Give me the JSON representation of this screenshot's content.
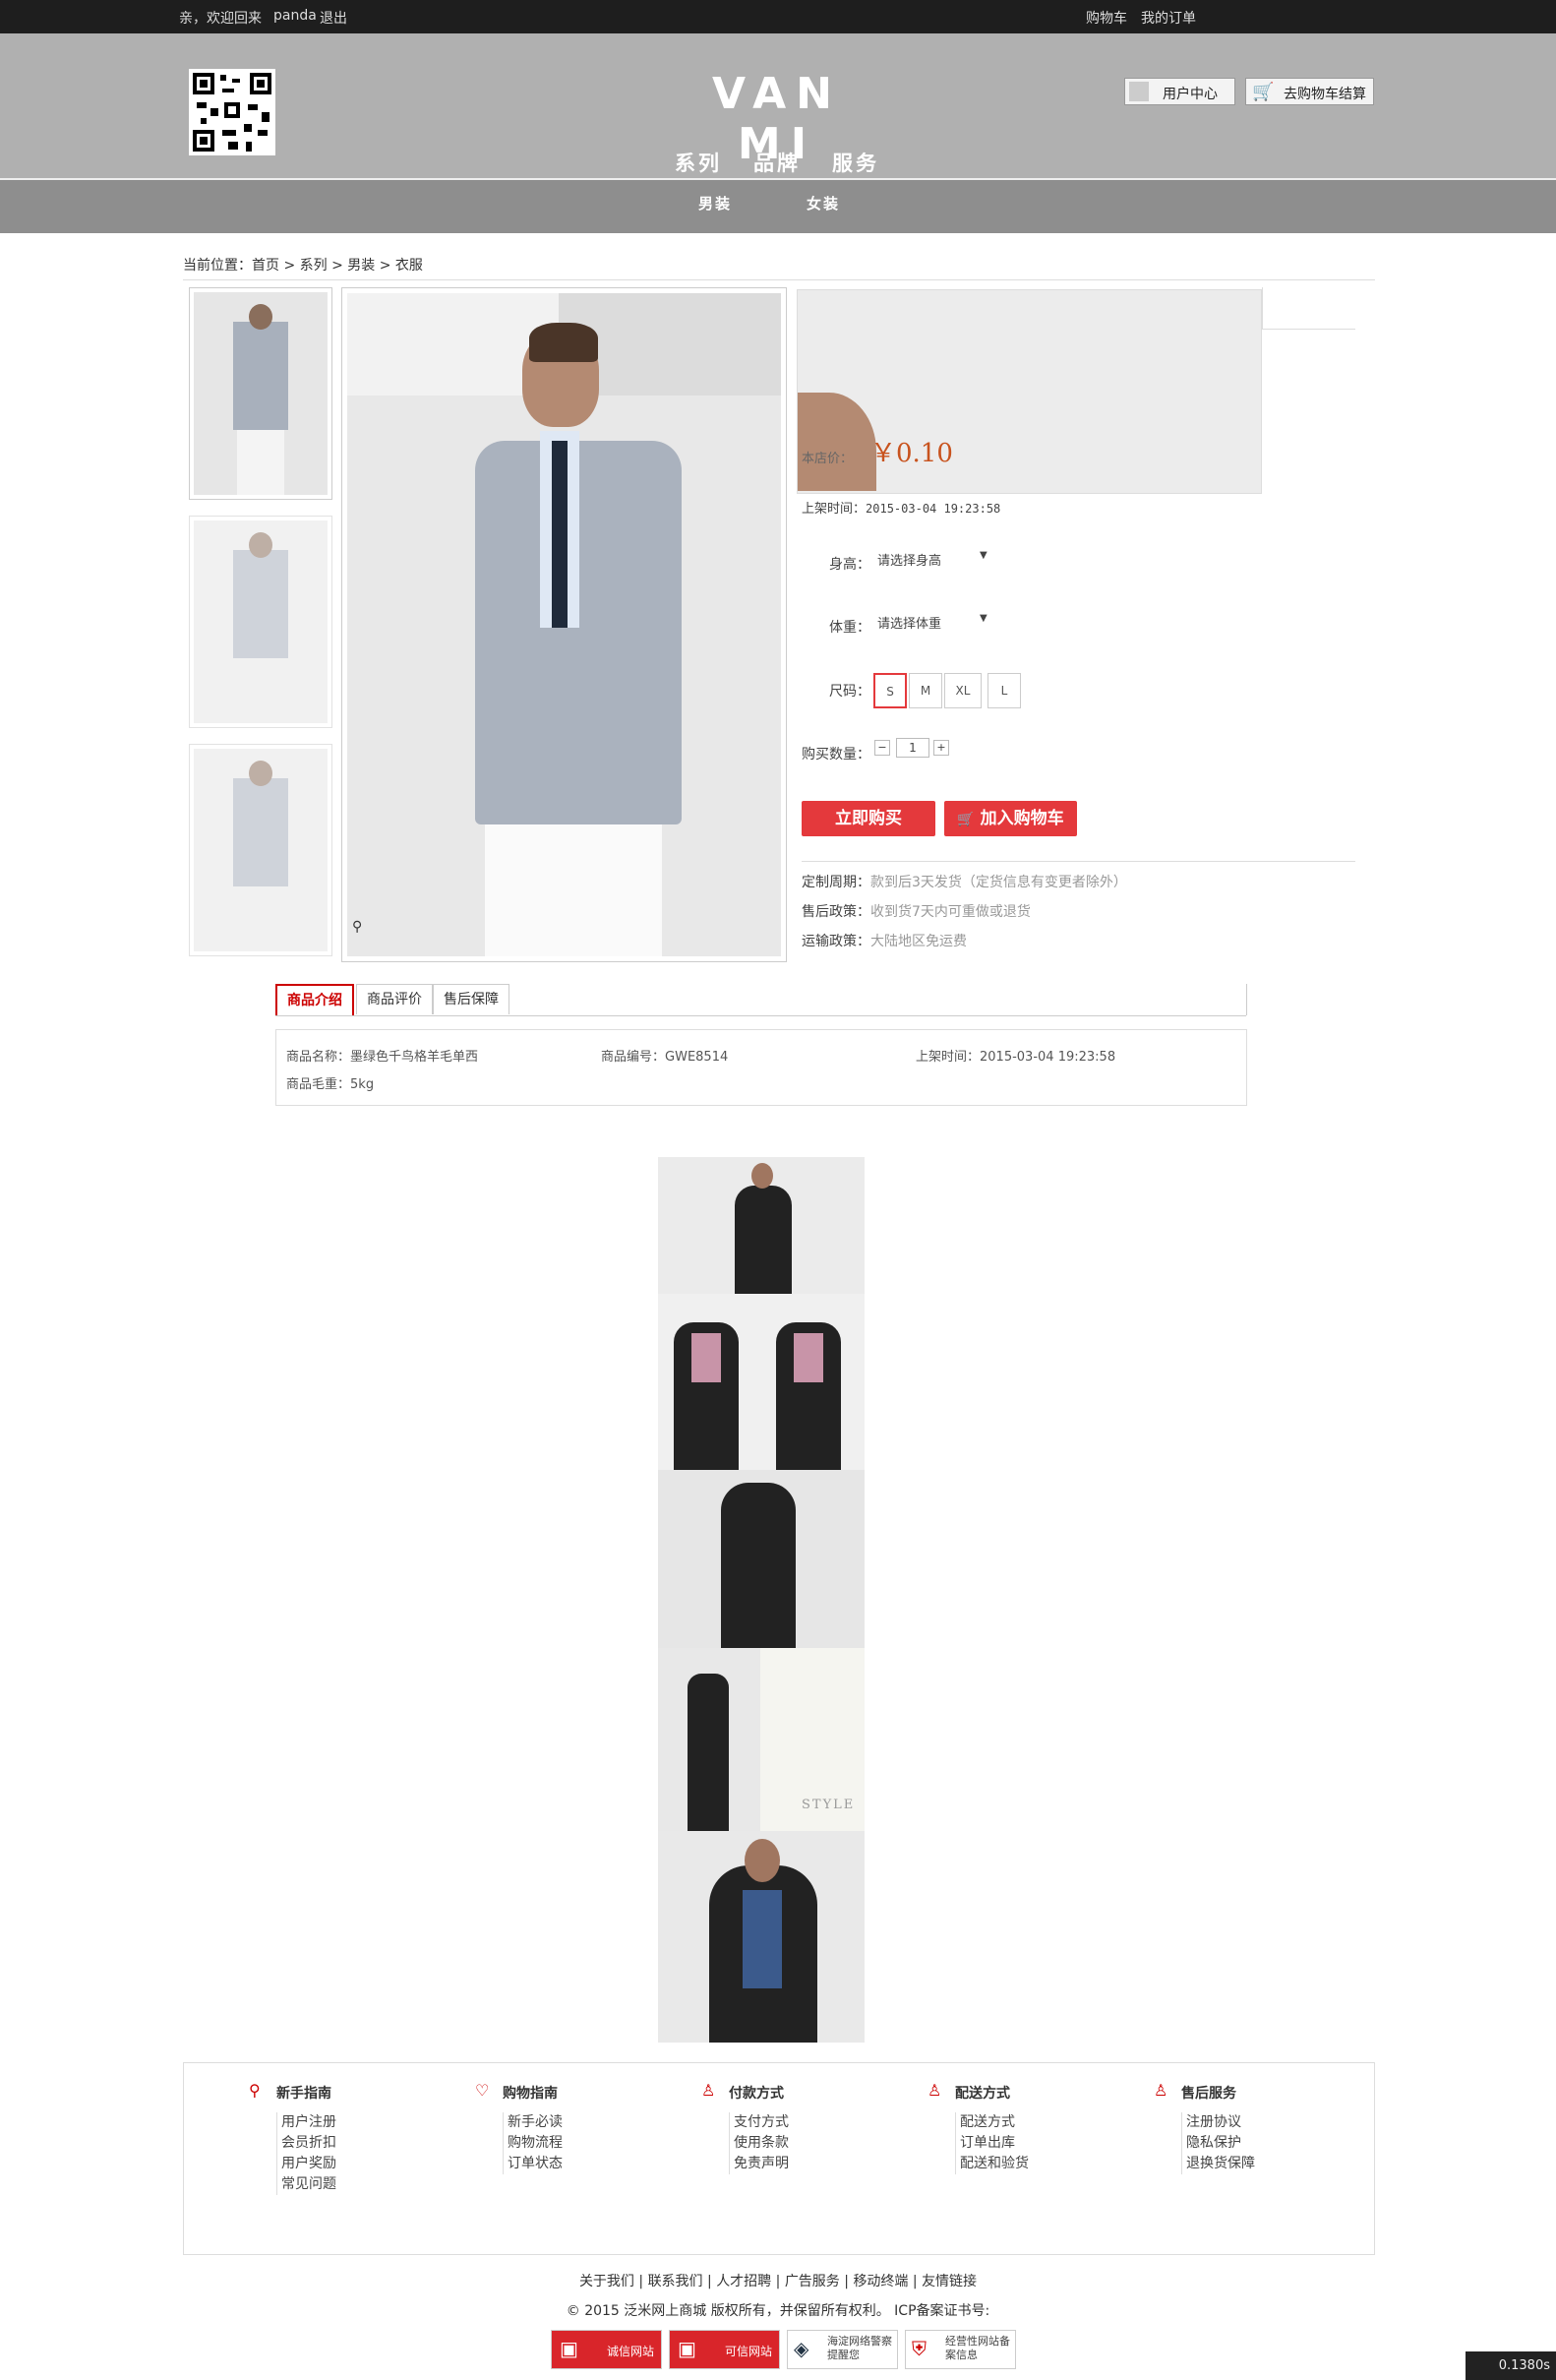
{
  "topbar": {
    "welcome": "亲，欢迎回来",
    "username": "panda",
    "logout": "退出",
    "cart": "购物车",
    "orders": "我的订单"
  },
  "header": {
    "logo": "VAN MI",
    "user_center": "用户中心",
    "checkout": "去购物车结算",
    "nav": [
      "系列",
      "品牌",
      "服务"
    ],
    "subnav": [
      "男装",
      "女装"
    ]
  },
  "breadcrumb": {
    "prefix": "当前位置：",
    "items": [
      "首页",
      "系列",
      "男装",
      "衣服"
    ],
    "sep": ">"
  },
  "product": {
    "price_label": "本店价：",
    "price": "￥0.10",
    "listed_label": "上架时间：",
    "listed": "2015-03-04 19:23:58",
    "height_label": "身高：",
    "height_placeholder": "请选择身高",
    "weight_label": "体重：",
    "weight_placeholder": "请选择体重",
    "size_label": "尺码：",
    "sizes": [
      "S",
      "M",
      "XL",
      "L"
    ],
    "selected_size": "S",
    "qty_label": "购买数量：",
    "qty": "1",
    "buy_now": "立即购买",
    "add_cart": "加入购物车",
    "policies": [
      {
        "label": "定制周期：",
        "value": "款到后3天发货（定货信息有变更者除外）"
      },
      {
        "label": "售后政策：",
        "value": "收到货7天内可重做或退货"
      },
      {
        "label": "运输政策：",
        "value": "大陆地区免运费"
      }
    ]
  },
  "tabs": [
    "商品介绍",
    "商品评价",
    "售后保障"
  ],
  "details": {
    "name_label": "商品名称：",
    "name": "墨绿色千鸟格羊毛单西",
    "code_label": "商品编号：",
    "code": "GWE8514",
    "time_label": "上架时间：",
    "time": "2015-03-04 19:23:58",
    "weight_label": "商品毛重：",
    "weight": "5kg"
  },
  "style_text": "STYLE",
  "footer": {
    "columns": [
      {
        "title": "新手指南",
        "items": [
          "用户注册",
          "会员折扣",
          "用户奖励",
          "常见问题"
        ]
      },
      {
        "title": "购物指南",
        "items": [
          "新手必读",
          "购物流程",
          "订单状态"
        ]
      },
      {
        "title": "付款方式",
        "items": [
          "支付方式",
          "使用条款",
          "免责声明"
        ]
      },
      {
        "title": "配送方式",
        "items": [
          "配送方式",
          "订单出库",
          "配送和验货"
        ]
      },
      {
        "title": "售后服务",
        "items": [
          "注册协议",
          "隐私保护",
          "退换货保障"
        ]
      }
    ],
    "links": [
      "关于我们",
      "联系我们",
      "人才招聘",
      "广告服务",
      "移动终端",
      "友情链接"
    ],
    "copyright": "© 2015 泛米网上商城 版权所有，并保留所有权利。 ICP备案证书号:",
    "badges": [
      "诚信网站",
      "可信网站",
      "海淀网络警察提醒您",
      "经营性网站备案信息"
    ]
  },
  "timer": "0.1380s",
  "colors": {
    "accent": "#e4393c",
    "price": "#c8531e",
    "topbar": "#1e1e1e",
    "header": "#b0b0b0"
  }
}
